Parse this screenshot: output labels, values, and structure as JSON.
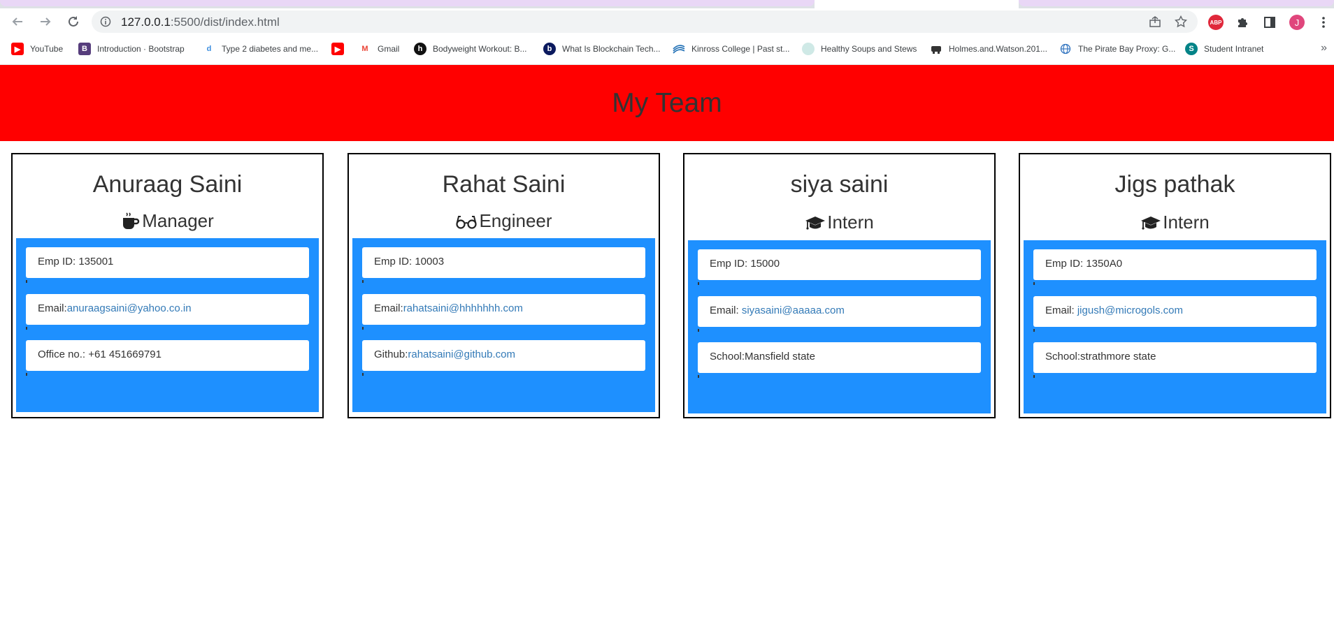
{
  "browser": {
    "url_host": "127.0.0.1",
    "url_path": ":5500/dist/index.html",
    "profile_initial": "J",
    "abp_label": "ABP",
    "bookmarks": [
      {
        "label": "YouTube",
        "icon": "youtube-icon",
        "color": "#ff0000"
      },
      {
        "label": "Introduction · Bootstrap",
        "icon": "bootstrap-icon",
        "color": "#563d7c"
      },
      {
        "label": "Type 2 diabetes and me...",
        "icon": "diabetes-site-icon",
        "color": "#3a8dde"
      },
      {
        "label": "",
        "icon": "youtube-icon",
        "color": "#ff0000"
      },
      {
        "label": "Gmail",
        "icon": "gmail-icon",
        "color": "#ea4335"
      },
      {
        "label": "Bodyweight Workout: B...",
        "icon": "workout-site-icon",
        "color": "#111111"
      },
      {
        "label": "What Is Blockchain Tech...",
        "icon": "blockchain-site-icon",
        "color": "#0b1a5e"
      },
      {
        "label": "Kinross College | Past st...",
        "icon": "kinross-college-icon",
        "color": "#1f6fb5"
      },
      {
        "label": "Healthy Soups and Stews",
        "icon": "soups-site-icon",
        "color": "#8fc9c4"
      },
      {
        "label": "Holmes.and.Watson.201...",
        "icon": "holmes-site-icon",
        "color": "#333333"
      },
      {
        "label": "The Pirate Bay Proxy: G...",
        "icon": "globe-icon",
        "color": "#2a6fbd"
      },
      {
        "label": "Student Intranet",
        "icon": "sharepoint-icon",
        "color": "#038387"
      }
    ],
    "more_label": "»"
  },
  "page": {
    "title": "My Team",
    "header_color": "#ff0000",
    "body_color": "#1e90ff"
  },
  "team": [
    {
      "name": "Anuraag Saini",
      "role": "Manager",
      "role_icon": "coffee-mug-icon",
      "rows": [
        {
          "label": "Emp ID: 135001",
          "link": ""
        },
        {
          "label": "Email:",
          "link": "anuraagsaini@yahoo.co.in"
        },
        {
          "label": "Office no.: +61 451669791",
          "link": ""
        }
      ]
    },
    {
      "name": "Rahat Saini",
      "role": "Engineer",
      "role_icon": "glasses-icon",
      "rows": [
        {
          "label": "Emp ID: 10003",
          "link": ""
        },
        {
          "label": "Email:",
          "link": "rahatsaini@hhhhhhh.com"
        },
        {
          "label": "Github:",
          "link": "rahatsaini@github.com"
        }
      ]
    },
    {
      "name": "siya saini",
      "role": "Intern",
      "role_icon": "graduation-cap-icon",
      "rows": [
        {
          "label": "Emp ID: 15000",
          "link": ""
        },
        {
          "label": "Email: ",
          "link": "siyasaini@aaaaa.com"
        },
        {
          "label": "School:Mansfield state",
          "link": ""
        }
      ]
    },
    {
      "name": "Jigs pathak",
      "role": "Intern",
      "role_icon": "graduation-cap-icon",
      "rows": [
        {
          "label": "Emp ID: 1350A0",
          "link": ""
        },
        {
          "label": "Email: ",
          "link": "jigush@microgols.com"
        },
        {
          "label": "School:strathmore state",
          "link": ""
        }
      ]
    }
  ]
}
